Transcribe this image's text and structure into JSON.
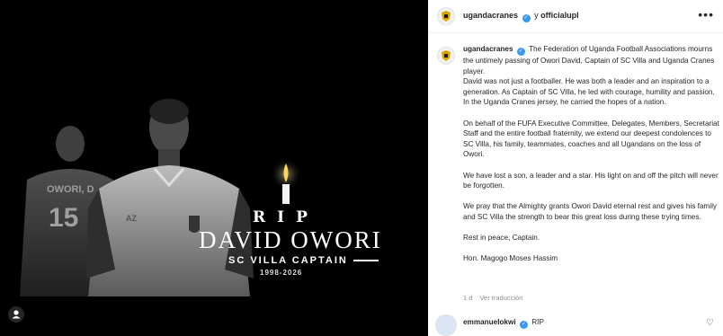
{
  "post": {
    "author": "ugandacranes",
    "connector": "y",
    "coauthor": "officialupl",
    "more_icon": "more-horizontal-icon",
    "verified_color": "#3897f0"
  },
  "image": {
    "rip": "RIP",
    "name": "DAVID OWORI",
    "role": "SC VILLA CAPTAIN",
    "years": "1998-2026",
    "jersey_name": "OWORI, D",
    "jersey_number": "15"
  },
  "caption": {
    "username": "ugandacranes",
    "paragraphs": [
      "The Federation of Uganda Football Associations mourns the untimely passing of Owori David, Captain of SC Villa and Uganda Cranes player.",
      "David was not just a footballer. He was both a leader and an inspiration to a generation. As Captain of SC Villa, he led with courage, humility and passion. In the Uganda Cranes jersey, he carried the hopes of a nation.",
      "On behalf of the FUFA Executive Committee, Delegates, Members, Secretariat Staff and the entire football fraternity, we extend our deepest condolences to SC Villa, his family, teammates, coaches and all Ugandans on the loss of Owori.",
      "We have lost a son, a leader and a star. His light on and off the pitch will never be forgotten.",
      "We pray that the Almighty grants Owori David eternal rest and gives his family and SC Villa the strength to bear this great loss during these trying times.",
      "Rest in peace, Captain.",
      "Hon. Magogo Moses Hassim"
    ],
    "time": "1 d",
    "translate": "Ver traducción"
  },
  "comment": {
    "username": "emmanuelokwi",
    "text": "RIP"
  }
}
